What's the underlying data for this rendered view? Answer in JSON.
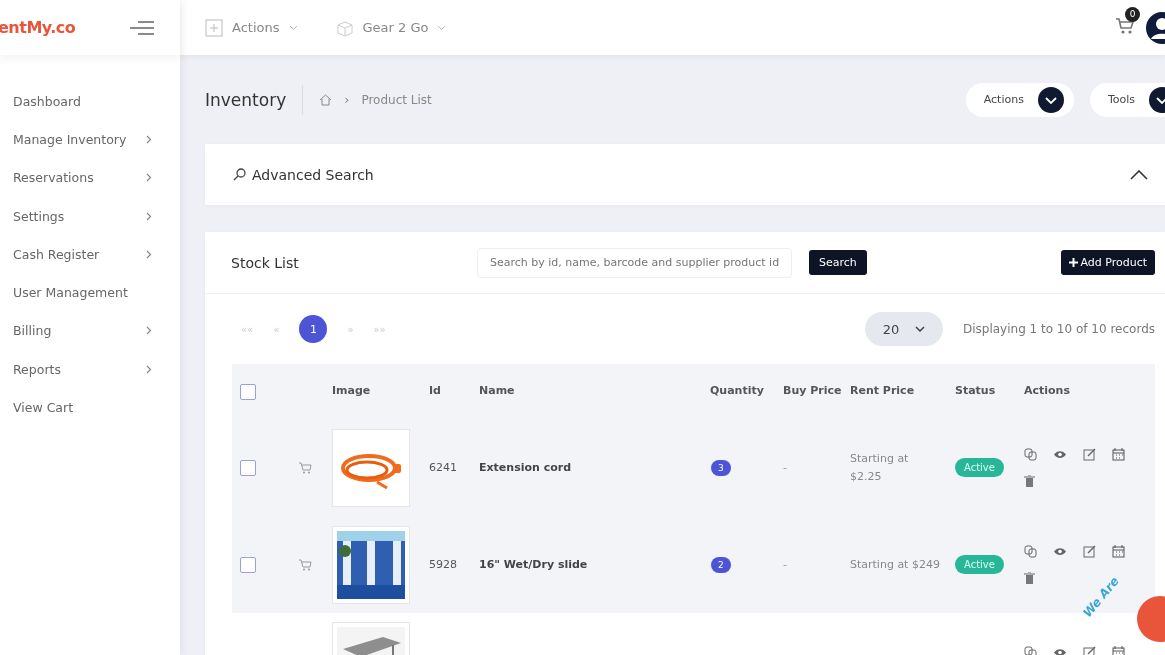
{
  "logo": "entMy.co",
  "topbar": {
    "menus": [
      {
        "label": "Actions"
      },
      {
        "label": "Gear 2 Go"
      }
    ],
    "cart_count": "0"
  },
  "sidebar": {
    "items": [
      {
        "label": "Dashboard",
        "has_submenu": false
      },
      {
        "label": "Manage Inventory",
        "has_submenu": true
      },
      {
        "label": "Reservations",
        "has_submenu": true
      },
      {
        "label": "Settings",
        "has_submenu": true
      },
      {
        "label": "Cash Register",
        "has_submenu": true
      },
      {
        "label": "User Management",
        "has_submenu": false
      },
      {
        "label": "Billing",
        "has_submenu": true
      },
      {
        "label": "Reports",
        "has_submenu": true
      },
      {
        "label": "View Cart",
        "has_submenu": false
      }
    ]
  },
  "page": {
    "title": "Inventory",
    "breadcrumb_separator": "›",
    "breadcrumb": "Product List",
    "buttons": [
      "Actions",
      "Tools"
    ]
  },
  "advanced_search": {
    "title": "Advanced Search",
    "expanded": true
  },
  "stock_list": {
    "title": "Stock List",
    "search": {
      "placeholder": "Search by id, name, barcode and supplier product id"
    },
    "search_button": "Search",
    "add_button": "Add Product",
    "select_all_checked": false,
    "pagination": {
      "first": "««",
      "prev": "«",
      "pages": [
        {
          "label": "1",
          "selected": true
        }
      ],
      "next": "»",
      "last": "»»"
    },
    "page_size": "20",
    "summary": "Displaying 1 to 10 of 10 records",
    "columns": [
      "Image",
      "Id",
      "Name",
      "Quantity",
      "Buy Price",
      "Rent Price",
      "Status",
      "Actions"
    ],
    "rows": [
      {
        "shaded": true,
        "checked": false,
        "id": "6241",
        "name": "Extension cord",
        "quantity": "3",
        "buy_price": "-",
        "rent_price": "Starting at $2.25",
        "status": "Active"
      },
      {
        "shaded": true,
        "checked": false,
        "id": "5928",
        "name": "16\" Wet/Dry slide",
        "quantity": "2",
        "buy_price": "-",
        "rent_price": "Starting at $249",
        "status": "Active"
      },
      {
        "shaded": false
      }
    ]
  },
  "chat_widget": {
    "label": "We Are"
  }
}
